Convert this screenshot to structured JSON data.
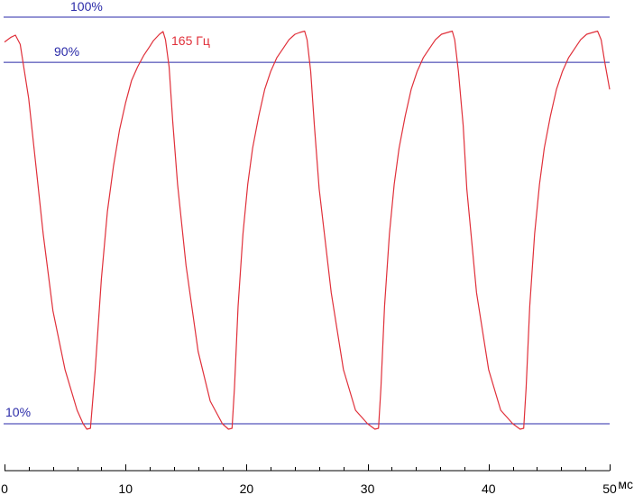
{
  "chart_data": {
    "type": "line",
    "title": "",
    "xlabel": "мс",
    "ylabel": "",
    "xlim": [
      0,
      50
    ],
    "ylim": [
      8,
      103
    ],
    "x_ticks": [
      0,
      10,
      20,
      30,
      40,
      50
    ],
    "x_minor_step": 2,
    "grid": false,
    "reference_lines": [
      {
        "label": "100%",
        "y": 100,
        "color": "#2a2aa8"
      },
      {
        "label": "90%",
        "y": 90,
        "color": "#2a2aa8"
      },
      {
        "label": "10%",
        "y": 10,
        "color": "#2a2aa8"
      }
    ],
    "series": [
      {
        "name": "165 Гц",
        "color": "#e0303a",
        "x": [
          0,
          0.5,
          0.9,
          1.3,
          2.0,
          2.6,
          3.2,
          4.0,
          5.0,
          6.0,
          6.5,
          6.8,
          7.1,
          7.5,
          8.0,
          8.5,
          9.0,
          9.5,
          10.0,
          10.5,
          11.0,
          11.5,
          12.0,
          12.3,
          12.8,
          13.1,
          13.3,
          13.6,
          13.9,
          14.3,
          15.0,
          16.0,
          17.0,
          18.0,
          18.5,
          18.8,
          19.0,
          19.3,
          19.7,
          20.1,
          20.5,
          21.0,
          21.5,
          22.0,
          22.5,
          23.0,
          23.5,
          24.0,
          24.4,
          24.8,
          25.0,
          25.3,
          25.6,
          26.0,
          27.0,
          28.0,
          29.0,
          30.0,
          30.6,
          30.9,
          31.1,
          31.4,
          31.8,
          32.2,
          32.6,
          33.1,
          33.6,
          34.1,
          34.6,
          35.1,
          35.6,
          36.1,
          36.6,
          37.0,
          37.2,
          37.5,
          37.9,
          38.2,
          39.0,
          40.0,
          41.0,
          42.0,
          42.6,
          42.9,
          43.1,
          43.4,
          43.8,
          44.2,
          44.6,
          45.1,
          45.6,
          46.1,
          46.6,
          47.1,
          47.6,
          48.1,
          48.6,
          49.0,
          49.3,
          49.6,
          50.0
        ],
        "y": [
          94.5,
          95.5,
          96,
          94,
          82,
          67,
          52,
          35,
          22,
          13,
          10,
          8.8,
          9,
          22,
          42,
          57,
          67,
          75,
          81,
          86,
          89,
          91.5,
          93.5,
          94.8,
          96.2,
          96.8,
          95,
          89,
          77,
          63,
          45,
          26,
          15,
          10,
          8.8,
          9,
          18,
          36,
          52,
          63,
          71,
          78,
          84,
          88,
          91,
          93,
          95,
          96.2,
          96.6,
          96.9,
          95,
          88,
          76,
          62,
          39,
          22,
          13,
          10,
          8.8,
          9,
          18,
          36,
          52,
          63,
          71,
          78,
          84,
          88,
          91,
          93,
          95,
          96.2,
          96.6,
          96.9,
          95,
          88,
          76,
          62,
          39,
          22,
          13,
          10,
          8.8,
          9,
          18,
          36,
          52,
          63,
          71,
          78,
          84,
          88,
          91,
          93,
          95,
          96.2,
          96.6,
          96.9,
          95,
          90,
          84
        ]
      }
    ]
  }
}
